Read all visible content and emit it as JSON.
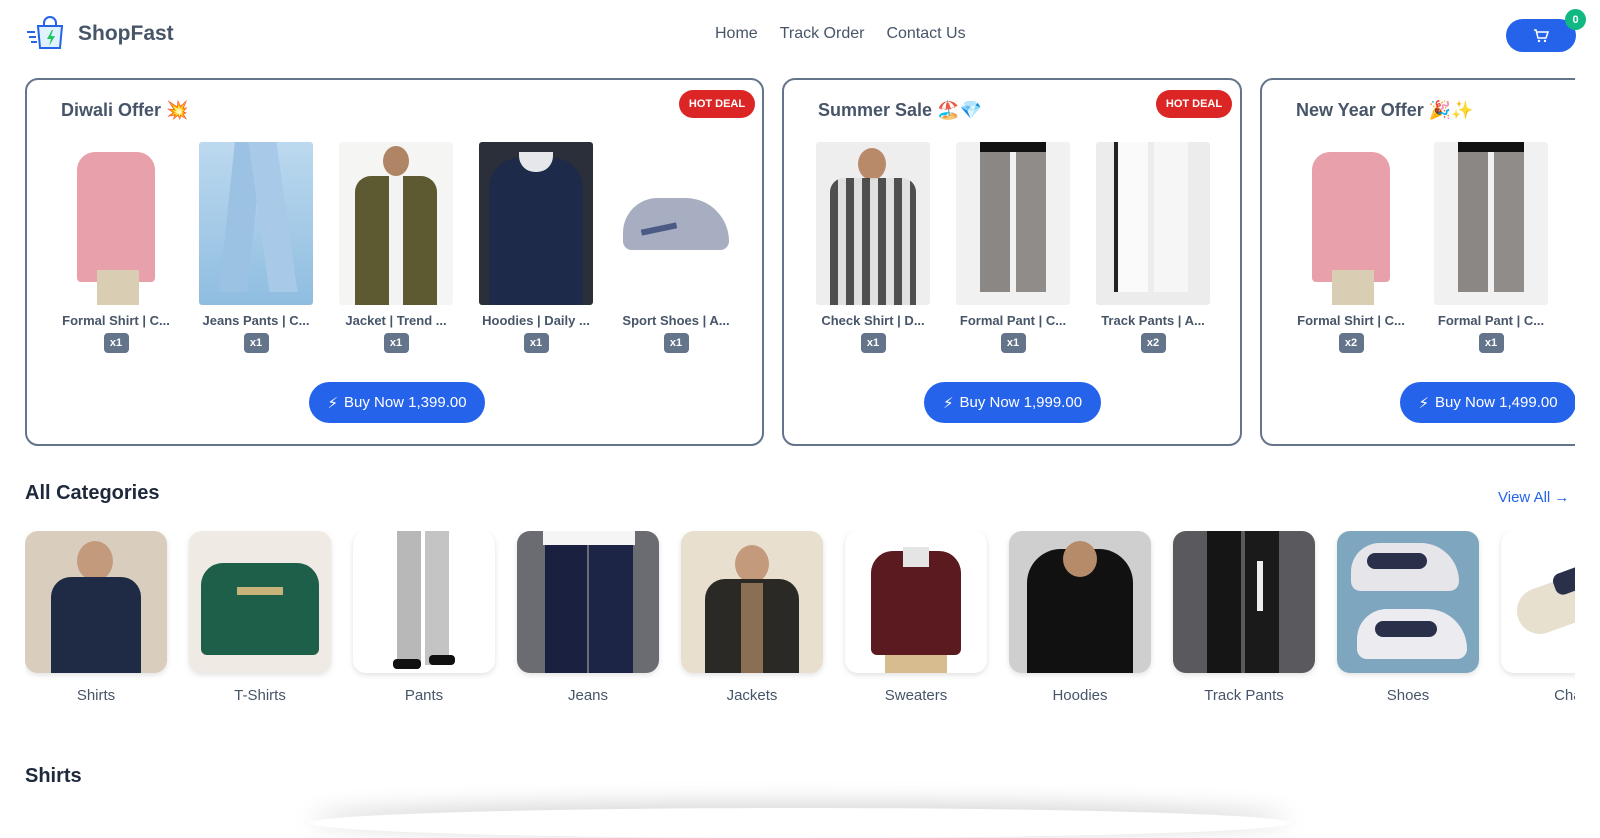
{
  "header": {
    "brand": "ShopFast",
    "nav": [
      {
        "label": "Home"
      },
      {
        "label": "Track Order"
      },
      {
        "label": "Contact Us"
      }
    ],
    "cart_count": "0"
  },
  "offers": [
    {
      "title": "Diwali Offer 💥",
      "badge": "HOT DEAL",
      "buy_label": "Buy Now 1,399.00",
      "products": [
        {
          "name": "Formal Shirt | C...",
          "qty": "x1"
        },
        {
          "name": "Jeans Pants | C...",
          "qty": "x1"
        },
        {
          "name": "Jacket | Trend ...",
          "qty": "x1"
        },
        {
          "name": "Hoodies | Daily ...",
          "qty": "x1"
        },
        {
          "name": "Sport Shoes | A...",
          "qty": "x1"
        }
      ]
    },
    {
      "title": "Summer Sale 🏖️💎",
      "badge": "HOT DEAL",
      "buy_label": "Buy Now 1,999.00",
      "products": [
        {
          "name": "Check Shirt | D...",
          "qty": "x1"
        },
        {
          "name": "Formal Pant | C...",
          "qty": "x1"
        },
        {
          "name": "Track Pants | A...",
          "qty": "x2"
        }
      ]
    },
    {
      "title": "New Year Offer 🎉✨",
      "buy_label": "Buy Now 1,499.00",
      "products": [
        {
          "name": "Formal Shirt | C...",
          "qty": "x2"
        },
        {
          "name": "Formal Pant | C...",
          "qty": "x1"
        }
      ]
    }
  ],
  "categories_section": {
    "title": "All Categories",
    "view_all": "View All →",
    "items": [
      {
        "label": "Shirts"
      },
      {
        "label": "T-Shirts"
      },
      {
        "label": "Pants"
      },
      {
        "label": "Jeans"
      },
      {
        "label": "Jackets"
      },
      {
        "label": "Sweaters"
      },
      {
        "label": "Hoodies"
      },
      {
        "label": "Track Pants"
      },
      {
        "label": "Shoes"
      },
      {
        "label": "Chap"
      }
    ]
  },
  "shirts_section": {
    "title": "Shirts"
  },
  "colors": {
    "accent": "#2563eb",
    "hot_badge": "#dc2626",
    "cart_badge": "#10b981"
  }
}
